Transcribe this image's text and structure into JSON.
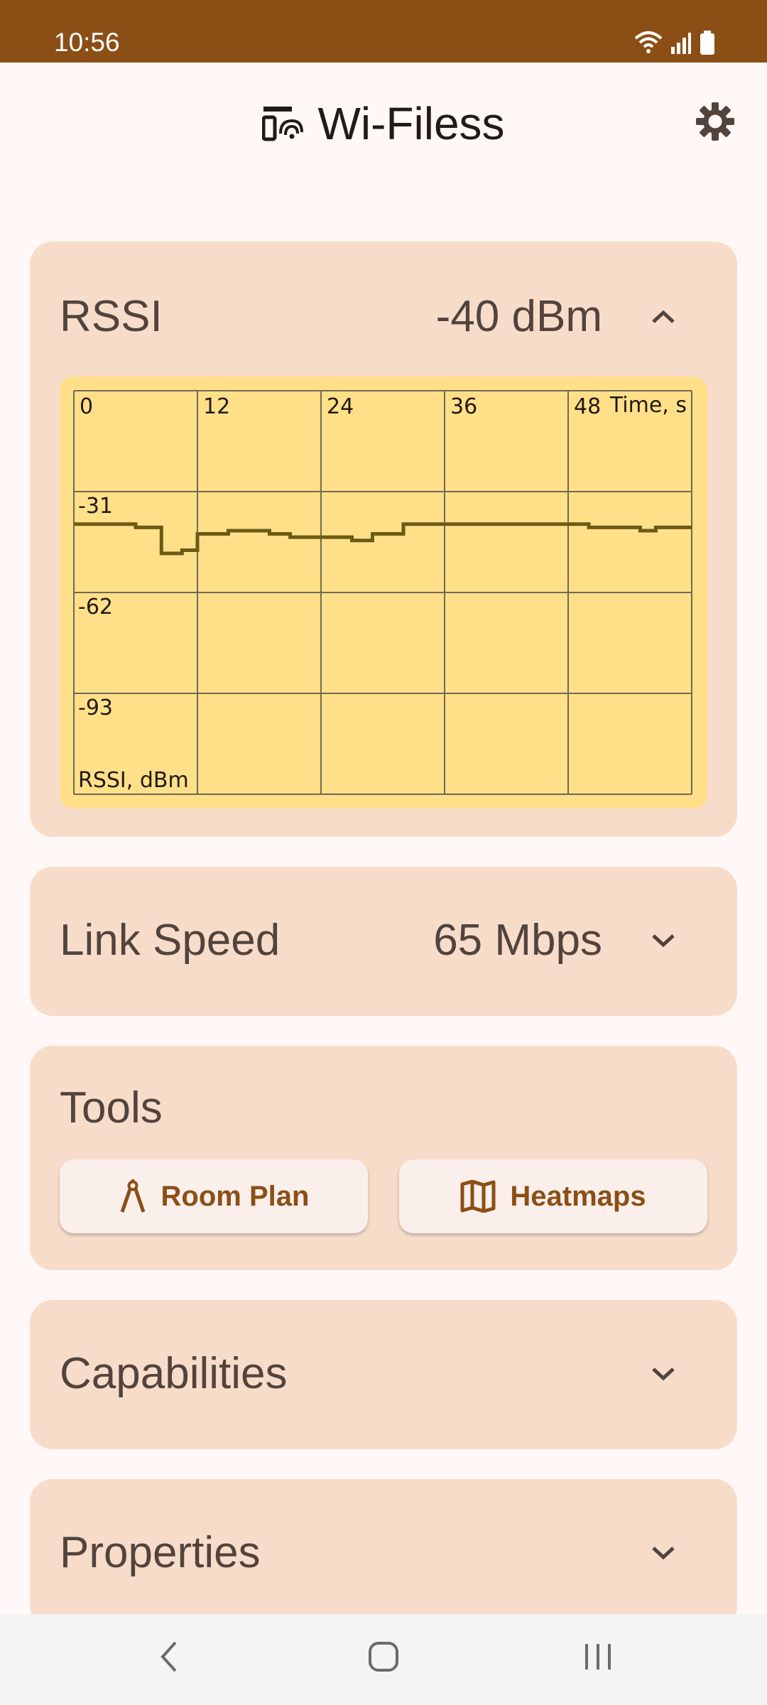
{
  "status_bar": {
    "time": "10:56"
  },
  "app": {
    "title": "Wi-Filess"
  },
  "rssi": {
    "title": "RSSI",
    "value": "-40 dBm"
  },
  "link_speed": {
    "title": "Link Speed",
    "value": "65 Mbps"
  },
  "tools": {
    "title": "Tools",
    "room_plan_label": "Room Plan",
    "heatmaps_label": "Heatmaps"
  },
  "capabilities": {
    "title": "Capabilities"
  },
  "properties": {
    "title": "Properties"
  },
  "colors": {
    "accent": "#8B4F16",
    "card_bg": "#F8DCCA",
    "chart_bg": "#FFE089",
    "series_line": "#6B5A14",
    "grid": "#6F6A55"
  },
  "icons": {
    "app_logo": "wifi-device-icon",
    "settings": "gear-icon",
    "rssi_toggle": "chevron-up-icon",
    "link_toggle": "chevron-down-icon",
    "room_plan": "compass-icon",
    "heatmaps": "map-icon",
    "nav_back": "back-icon",
    "nav_home": "home-icon",
    "nav_recents": "recents-icon"
  },
  "chart_data": {
    "type": "line",
    "xlabel": "Time, s",
    "ylabel": "RSSI, dBm",
    "x_ticks": [
      "0",
      "12",
      "24",
      "36",
      "48"
    ],
    "y_ticks": [
      "-31",
      "-62",
      "-93"
    ],
    "xlim": [
      0,
      60
    ],
    "ylim": [
      -124,
      0
    ],
    "grid": true,
    "series": [
      {
        "x": [
          0,
          6,
          6,
          8.5,
          8.5,
          10.5,
          10.5,
          12,
          12,
          15,
          15,
          19,
          19,
          21,
          21,
          27,
          27,
          29,
          29,
          32,
          32,
          34,
          34,
          36,
          36,
          45.5,
          45.5,
          48,
          48,
          50,
          50,
          55,
          55,
          56.5,
          56.5,
          59,
          59,
          60
        ],
        "y": [
          -41,
          -41,
          -42,
          -42,
          -50,
          -50,
          -49,
          -49,
          -44,
          -44,
          -43,
          -43,
          -44,
          -44,
          -45,
          -45,
          -46,
          -46,
          -44,
          -44,
          -41,
          -41,
          -41,
          -41,
          -41,
          -41,
          -41,
          -41,
          -41,
          -41,
          -42,
          -42,
          -43,
          -43,
          -42,
          -42,
          -42,
          -42
        ]
      }
    ]
  }
}
